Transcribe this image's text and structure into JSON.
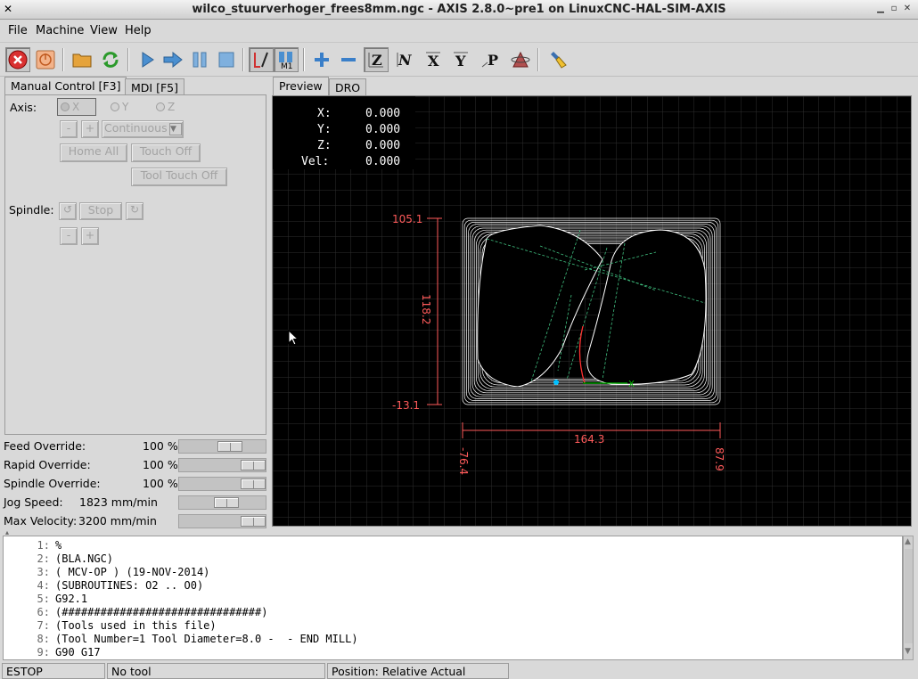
{
  "window": {
    "title": "wilco_stuurverhoger_frees8mm.ngc - AXIS 2.8.0~pre1 on LinuxCNC-HAL-SIM-AXIS"
  },
  "menu": [
    "File",
    "Machine",
    "View",
    "Help"
  ],
  "toolbar": {
    "icons": [
      "estop-icon",
      "machine-power-icon",
      "open-file-icon",
      "reload-icon",
      "run-icon",
      "step-icon",
      "pause-icon",
      "stop-icon",
      "block-delete-icon",
      "optional-stop-icon",
      "zoom-in-icon",
      "zoom-out-icon",
      "view-z-icon",
      "view-z2-icon",
      "view-x-icon",
      "view-y-icon",
      "view-p-icon",
      "rotate-view-icon",
      "clear-live-plot-icon"
    ]
  },
  "left_tabs": [
    "Manual Control [F3]",
    "MDI [F5]"
  ],
  "manual": {
    "axis_label": "Axis:",
    "axes": [
      "X",
      "Y",
      "Z"
    ],
    "selected_axis": "X",
    "jog_minus": "-",
    "jog_plus": "+",
    "jog_mode": "Continuous",
    "home_all": "Home All",
    "touch_off": "Touch Off",
    "tool_touch_off": "Tool Touch Off",
    "spindle_label": "Spindle:",
    "spindle_stop": "Stop",
    "spindle_minus": "-",
    "spindle_plus": "+"
  },
  "overrides": [
    {
      "label": "Feed Override:",
      "value": "100 %",
      "fraction": 0.62
    },
    {
      "label": "Rapid Override:",
      "value": "100 %",
      "fraction": 1.0
    },
    {
      "label": "Spindle Override:",
      "value": "100 %",
      "fraction": 1.0
    },
    {
      "label": "Jog Speed:",
      "value": "1823 mm/min",
      "fraction": 0.57
    },
    {
      "label": "Max Velocity:",
      "value": "3200 mm/min",
      "fraction": 1.0
    }
  ],
  "right_tabs": [
    "Preview",
    "DRO"
  ],
  "dro": {
    "x_label": "X:",
    "x_value": "0.000",
    "y_label": "Y:",
    "y_value": "0.000",
    "z_label": "Z:",
    "z_value": "0.000",
    "vel_label": "Vel:",
    "vel_value": "0.000"
  },
  "dimensions": {
    "y_max": "105.1",
    "y_min": "-13.1",
    "y_span": "118.2",
    "x_span": "164.3",
    "x_min": "-76.4",
    "x_max": "87.9",
    "origin_axis": "X"
  },
  "colors": {
    "dim_line": "#ff5a5a",
    "toolpath": "#ffffff",
    "rapid": "#3fbf7f",
    "x_axis": "#00c000",
    "origin": "#00c0ff"
  },
  "gcode": [
    {
      "n": "1:",
      "text": "%"
    },
    {
      "n": "2:",
      "text": "(BLA.NGC)"
    },
    {
      "n": "3:",
      "text": "( MCV-OP ) (19-NOV-2014)"
    },
    {
      "n": "4:",
      "text": "(SUBROUTINES: O2 .. O0)"
    },
    {
      "n": "5:",
      "text": "G92.1"
    },
    {
      "n": "6:",
      "text": "(###############################)"
    },
    {
      "n": "7:",
      "text": "(Tools used in this file)"
    },
    {
      "n": "8:",
      "text": "(Tool Number=1 Tool Diameter=8.0 -  - END MILL)"
    },
    {
      "n": "9:",
      "text": "G90 G17"
    }
  ],
  "status": {
    "machine": "ESTOP",
    "tool": "No tool",
    "position": "Position: Relative Actual"
  }
}
